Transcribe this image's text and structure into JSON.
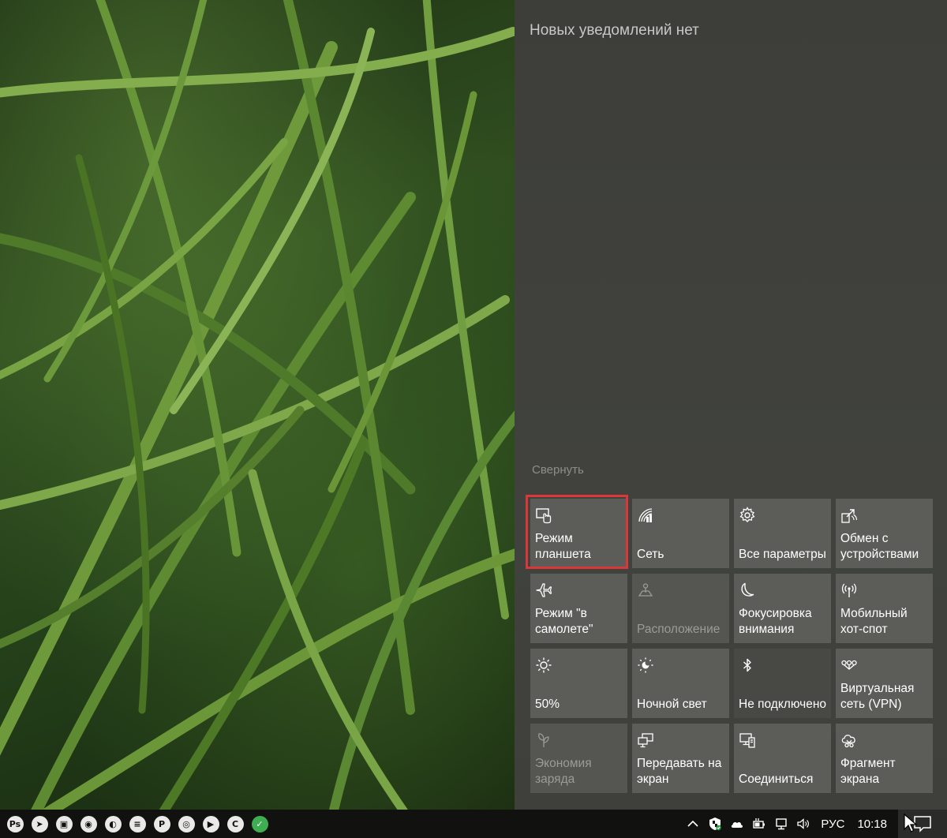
{
  "action_center": {
    "no_notifications": "Новых уведомлений нет",
    "collapse_label": "Свернуть",
    "tiles": [
      {
        "label": "Режим планшета",
        "icon": "tablet-mode-icon",
        "state": "normal"
      },
      {
        "label": "Сеть",
        "icon": "network-icon",
        "state": "normal"
      },
      {
        "label": "Все параметры",
        "icon": "gear-icon",
        "state": "normal"
      },
      {
        "label": "Обмен с устройствами",
        "icon": "nearby-sharing-icon",
        "state": "normal"
      },
      {
        "label": "Режим \"в самолете\"",
        "icon": "airplane-icon",
        "state": "normal"
      },
      {
        "label": "Расположение",
        "icon": "location-icon",
        "state": "disabled"
      },
      {
        "label": "Фокусировка внимания",
        "icon": "moon-icon",
        "state": "normal"
      },
      {
        "label": "Мобильный хот-спот",
        "icon": "hotspot-icon",
        "state": "normal"
      },
      {
        "label": "50%",
        "icon": "brightness-icon",
        "state": "normal"
      },
      {
        "label": "Ночной свет",
        "icon": "night-light-icon",
        "state": "normal"
      },
      {
        "label": "Не подключено",
        "icon": "bluetooth-icon",
        "state": "off"
      },
      {
        "label": "Виртуальная сеть (VPN)",
        "icon": "vpn-icon",
        "state": "normal"
      },
      {
        "label": "Экономия заряда",
        "icon": "battery-saver-icon",
        "state": "disabled"
      },
      {
        "label": "Передавать на экран",
        "icon": "project-icon",
        "state": "normal"
      },
      {
        "label": "Соединиться",
        "icon": "connect-icon",
        "state": "normal"
      },
      {
        "label": "Фрагмент экрана",
        "icon": "snip-icon",
        "state": "normal"
      }
    ]
  },
  "taskbar": {
    "apps": [
      {
        "name": "photoshop-icon",
        "glyph": "Ps"
      },
      {
        "name": "telegram-icon",
        "glyph": "➤"
      },
      {
        "name": "photos-icon",
        "glyph": "▣"
      },
      {
        "name": "chrome-icon",
        "glyph": "◉"
      },
      {
        "name": "firefox-icon",
        "glyph": "◐"
      },
      {
        "name": "winrar-icon",
        "glyph": "≡"
      },
      {
        "name": "pdf-icon",
        "glyph": "P"
      },
      {
        "name": "media-icon",
        "glyph": "◎"
      },
      {
        "name": "play-icon",
        "glyph": "▶"
      },
      {
        "name": "ccleaner-icon",
        "glyph": "C"
      },
      {
        "name": "vpn-app-icon",
        "glyph": "✓"
      }
    ],
    "language": "РУС",
    "time": "10:18"
  },
  "colors": {
    "panel_bg": "#3f403c",
    "tile_bg": "#5c5d59",
    "highlight": "#d9373a",
    "taskbar_bg": "#111210"
  }
}
